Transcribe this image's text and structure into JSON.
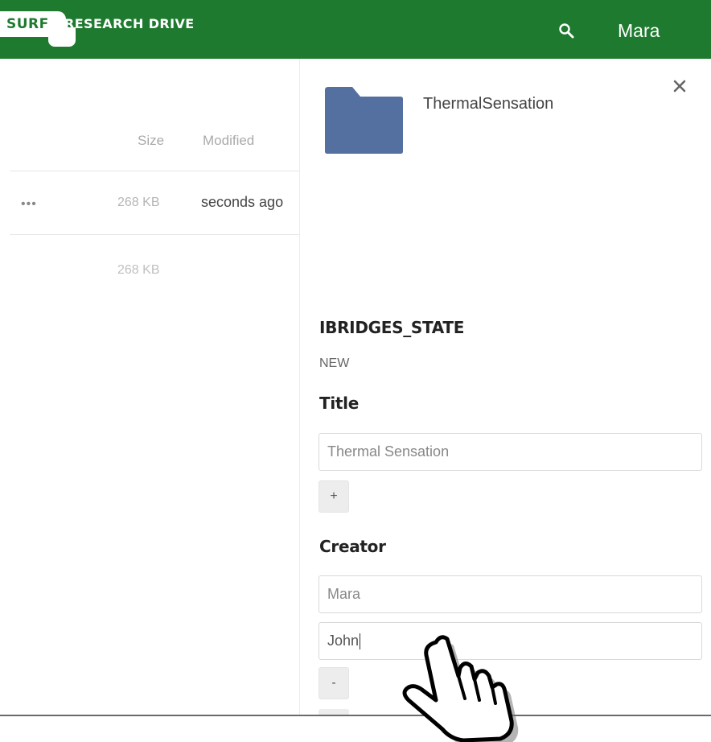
{
  "header": {
    "logo_surf": "SURF",
    "logo_text": "RESEARCH DRIVE",
    "user_name": "Mara",
    "colors": {
      "bar": "#1e7a2f",
      "text": "#ffffff"
    },
    "icons": {
      "search": "search-icon"
    }
  },
  "file_list": {
    "columns": {
      "size": "Size",
      "modified": "Modified"
    },
    "rows": [
      {
        "actions": "•••",
        "size": "268 KB",
        "modified": "seconds ago"
      }
    ],
    "total_size": "268 KB"
  },
  "details": {
    "folder_name": "ThermalSensation",
    "folder_color": "#5470a0",
    "icons": {
      "close": "close-icon",
      "folder": "folder-icon"
    },
    "state": {
      "label": "IBRIDGES_STATE",
      "value": "NEW"
    },
    "title": {
      "label": "Title",
      "placeholder": "Thermal Sensation",
      "add_button": "+"
    },
    "creator": {
      "label": "Creator",
      "placeholder": "Mara",
      "second_value": "John",
      "remove_button": "-"
    }
  }
}
